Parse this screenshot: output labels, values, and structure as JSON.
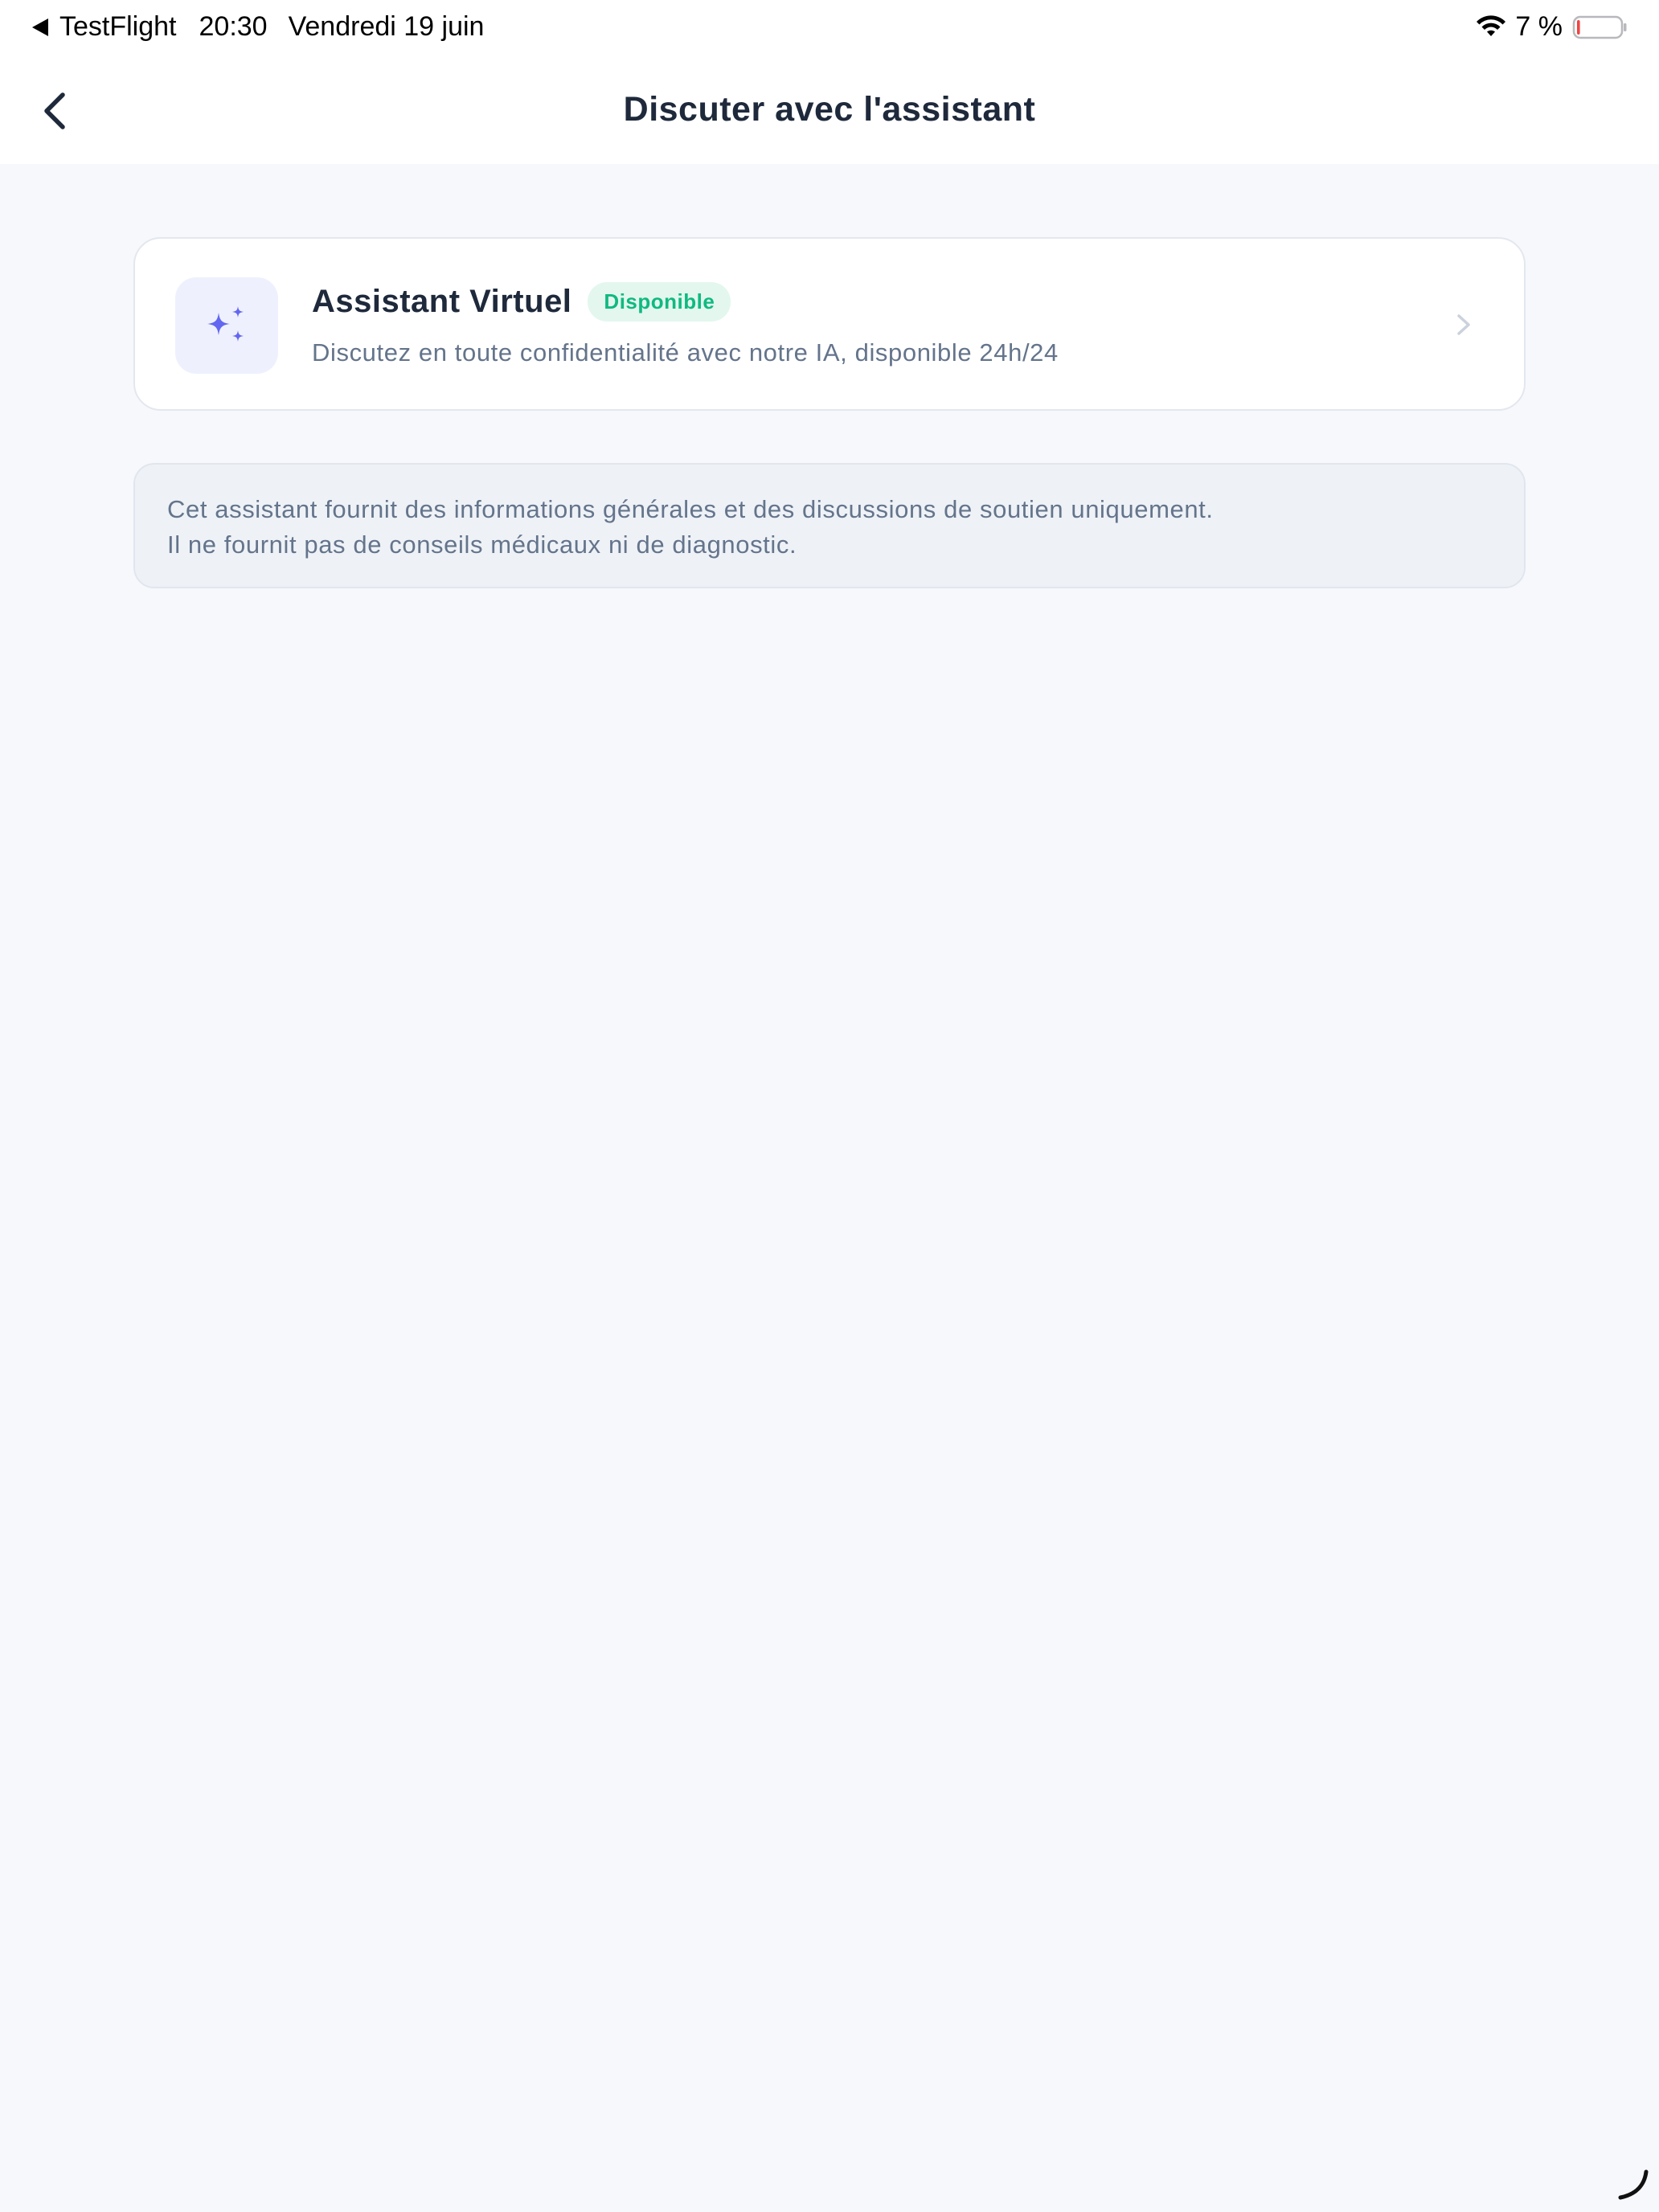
{
  "status_bar": {
    "back_app": "TestFlight",
    "time": "20:30",
    "date": "Vendredi 19 juin",
    "battery_percent": "7 %",
    "battery_level": 0.07,
    "icons": [
      "back-triangle-icon",
      "wifi-icon",
      "battery-icon"
    ]
  },
  "nav": {
    "title": "Discuter avec l'assistant",
    "back_icon": "chevron-left-icon"
  },
  "assistant_card": {
    "title": "Assistant Virtuel",
    "badge": "Disponible",
    "subtitle": "Discutez en toute confidentialité avec notre IA, disponible 24h/24",
    "icon": "sparkles-icon",
    "chevron_icon": "chevron-right-icon"
  },
  "disclaimer": {
    "line1": "Cet assistant fournit des informations générales et des discussions de soutien uniquement.",
    "line2": "Il ne fournit pas de conseils médicaux ni de diagnostic."
  },
  "colors": {
    "background": "#f7f8fc",
    "accent": "#6366f1",
    "badge_text": "#10b981",
    "badge_bg": "#e3f7ee",
    "title_text": "#1e293b",
    "muted_text": "#64748b",
    "battery_low": "#ef4444"
  }
}
